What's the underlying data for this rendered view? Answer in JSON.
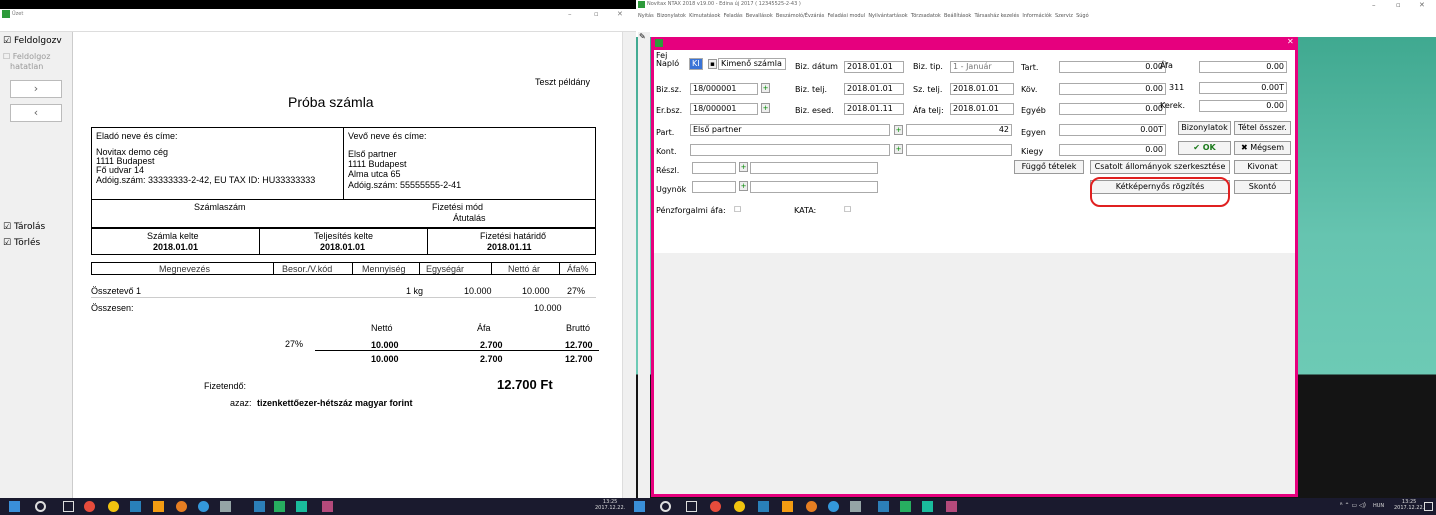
{
  "left_window": {
    "title": "Üzet",
    "sidebar": {
      "feldolgozva": "Feldolgozv",
      "feldolgozatlan_1": "Feldolgoz",
      "feldolgozatlan_2": "hatatlan",
      "nav_next": "›",
      "nav_prev": "‹",
      "tarolas": "Tárolás",
      "torles": "Törlés"
    },
    "invoice": {
      "sample_label": "Teszt példány",
      "title": "Próba számla",
      "seller_header": "Eladó neve és címe:",
      "seller_name": "Novitax demo cég",
      "seller_city": "1111 Budapest",
      "seller_street": "Fő udvar 14",
      "seller_tax": "Adóig.szám: 33333333-2-42, EU TAX ID: HU33333333",
      "buyer_header": "Vevő neve és címe:",
      "buyer_name": "Első partner",
      "buyer_city": "1111 Budapest",
      "buyer_street": "Alma utca 65",
      "buyer_tax": "Adóig.szám: 55555555-2-41",
      "invoice_no_label": "Számlaszám",
      "payment_label": "Fizetési mód",
      "payment_value": "Átutalás",
      "date_label": "Számla kelte",
      "date_value": "2018.01.01",
      "perf_label": "Teljesítés kelte",
      "perf_value": "2018.01.01",
      "due_label": "Fizetési határidő",
      "due_value": "2018.01.11",
      "columns": [
        "Megnevezés",
        "Besor./V.kód",
        "Mennyiség",
        "Egységár",
        "Nettó ár",
        "Áfa%"
      ],
      "item": {
        "name": "Összetevő 1",
        "qty": "1 kg",
        "unit": "10.000",
        "net": "10.000",
        "vat": "27%"
      },
      "sum_label": "Összesen:",
      "sum_net": "10.000",
      "tot_h_net": "Nettó",
      "tot_h_vat": "Áfa",
      "tot_h_gross": "Bruttó",
      "tot_rate": "27%",
      "tot_net": "10.000",
      "tot_vat": "2.700",
      "tot_gross": "12.700",
      "tot2_net": "10.000",
      "tot2_vat": "2.700",
      "tot2_gross": "12.700",
      "payable_label": "Fizetendő:",
      "payable_value": "12.700  Ft",
      "words_label": "azaz:",
      "words_value": "tizenkettőezer-hétszáz magyar forint"
    }
  },
  "right_window": {
    "title": "Novitax NTAX 2018 v19.00 - Edina új 2017 ( 12345525-2-43 )",
    "menu": [
      "Nyitás",
      "Bizonylatok",
      "Kimutatások",
      "Feladás",
      "Bevallások",
      "Beszámoló/Évzárás",
      "Feladási modul",
      "Nyilvántartások",
      "Törzsadatok",
      "Beállítások",
      "Társasház kezelés",
      "Információk",
      "Szerviz",
      "Súgó"
    ],
    "form": {
      "fej": "Fej",
      "naplo_label": "Napló",
      "naplo_code": "KI",
      "naplo_name": "Kimenő számla na",
      "bizdatum_label": "Biz. dátum",
      "bizdatum": "2018.01.01",
      "biztip_label": "Biz. tip.",
      "biztip": "1 - Január",
      "tart_label": "Tart.",
      "tart": "0.00",
      "afa_label": "Áfa",
      "afa": "0.00",
      "bizsz_label": "Biz.sz.",
      "bizsz": "18/000001",
      "biztelj_label": "Biz. telj.",
      "biztelj": "2018.01.01",
      "sztelj_label": "Sz. telj.",
      "sztelj": "2018.01.01",
      "kov_label": "Köv.",
      "kov": "0.00",
      "a311_label": "311",
      "a311": "0.00T",
      "erbsz_label": "Er.bsz.",
      "erbsz": "18/000001",
      "bizesed_label": "Biz. esed.",
      "bizesed": "2018.01.11",
      "afatelj_label": "Áfa telj:",
      "afatelj": "2018.01.01",
      "egyeb_label": "Egyéb",
      "egyeb": "0.00",
      "kerek_label": "Kerek.",
      "kerek": "0.00",
      "part_label": "Part.",
      "part": "Első partner",
      "part_num": "42",
      "egyen_label": "Egyen",
      "egyen": "0.00T",
      "kont_label": "Kont.",
      "kiegy_label": "Kiegy",
      "kiegy": "0.00",
      "reszl_label": "Részl.",
      "ugynok_label": "Ugynök",
      "penz_label": "Pénzforgalmi áfa:",
      "kata_label": "KATA:"
    },
    "buttons": {
      "bizonylatok": "Bizonylatok",
      "tetel_osszer": "Tétel összer.",
      "ok": "✔ OK",
      "megsem": "✖ Mégsem",
      "fuggo": "Függő tételek",
      "csatolt": "Csatolt állományok szerkesztése",
      "kivonat": "Kivonat",
      "ketkep": "Kétképernyős rögzítés",
      "skonto": "Skontó"
    }
  },
  "taskbar": {
    "time_left": "13:25",
    "date_left": "2017.12.22.",
    "lang": "HUN",
    "time_right": "13:25",
    "date_right": "2017.12.22."
  },
  "colors": {
    "dialog_border": "#e6007e",
    "desktop": "#66c4b0",
    "highlight_circle": "#e02020"
  }
}
